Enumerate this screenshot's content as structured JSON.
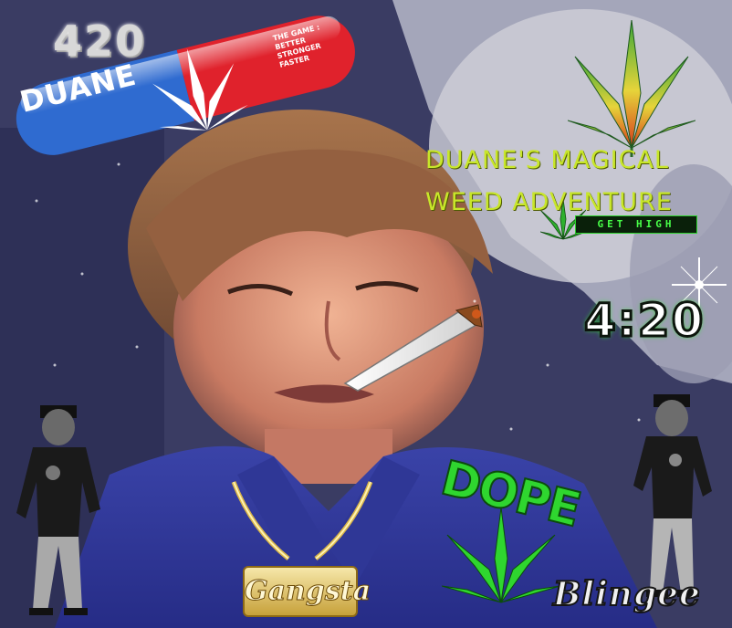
{
  "logo": {
    "number": "420",
    "pill_name": "DUANE",
    "tagline": [
      "THE GAME :",
      "BETTER",
      "STRONGER",
      "FASTER"
    ],
    "colors": {
      "blue": "#2f6bd0",
      "red": "#e0222c"
    }
  },
  "title": {
    "line1": "DUANE'S MAGICAL",
    "line2": "WEED ADVENTURE",
    "color": "#c8e62a"
  },
  "get_high": "GET HIGH",
  "clock": "4:20",
  "dope": "DOPE",
  "pendant": "Gangsta",
  "watermark": "Blingee",
  "icons": [
    "leaf-icon",
    "joint-icon",
    "sparkle-icon",
    "dancer-figure",
    "chain-necklace"
  ]
}
